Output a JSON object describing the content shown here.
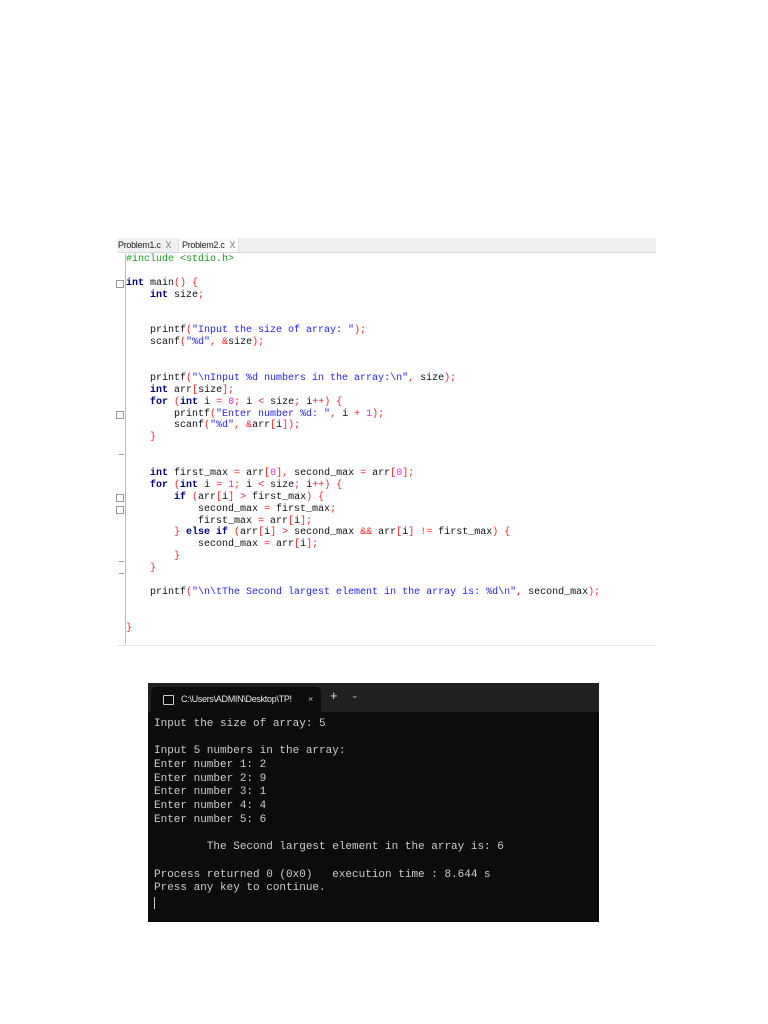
{
  "editor": {
    "tabs": [
      {
        "label": "Problem1.c",
        "close": "X"
      },
      {
        "label": "Problem2.c",
        "close": "X"
      }
    ],
    "code_lines": [
      [
        [
          "#include <stdio.h>",
          "pp"
        ]
      ],
      [],
      [
        [
          "int",
          "kw"
        ],
        [
          " main",
          "id"
        ],
        [
          "() {",
          "op"
        ]
      ],
      [
        [
          "    ",
          ""
        ],
        [
          "int",
          "kw"
        ],
        [
          " size",
          "id"
        ],
        [
          ";",
          "op"
        ]
      ],
      [],
      [],
      [
        [
          "    printf",
          "id"
        ],
        [
          "(",
          "op"
        ],
        [
          "\"Input the size of array: \"",
          "st"
        ],
        [
          ");",
          "op"
        ]
      ],
      [
        [
          "    scanf",
          "id"
        ],
        [
          "(",
          "op"
        ],
        [
          "\"%d\"",
          "st"
        ],
        [
          ", &",
          "op"
        ],
        [
          "size",
          "id"
        ],
        [
          ");",
          "op"
        ]
      ],
      [],
      [],
      [
        [
          "    printf",
          "id"
        ],
        [
          "(",
          "op"
        ],
        [
          "\"\\nInput %d numbers in the array:\\n\"",
          "st"
        ],
        [
          ", ",
          "op"
        ],
        [
          "size",
          "id"
        ],
        [
          ");",
          "op"
        ]
      ],
      [
        [
          "    ",
          ""
        ],
        [
          "int",
          "kw"
        ],
        [
          " arr",
          "id"
        ],
        [
          "[",
          "op"
        ],
        [
          "size",
          "id"
        ],
        [
          "];",
          "op"
        ]
      ],
      [
        [
          "    ",
          ""
        ],
        [
          "for",
          "kw"
        ],
        [
          " (",
          "op"
        ],
        [
          "int",
          "kw"
        ],
        [
          " i ",
          "id"
        ],
        [
          "=",
          "op"
        ],
        [
          " ",
          ""
        ],
        [
          "0",
          "nu"
        ],
        [
          ";",
          "op"
        ],
        [
          " i ",
          "id"
        ],
        [
          "<",
          "op"
        ],
        [
          " size",
          "id"
        ],
        [
          ";",
          "op"
        ],
        [
          " i",
          "id"
        ],
        [
          "++) {",
          "op"
        ]
      ],
      [
        [
          "        printf",
          "id"
        ],
        [
          "(",
          "op"
        ],
        [
          "\"Enter number %d: \"",
          "st"
        ],
        [
          ", ",
          "op"
        ],
        [
          "i ",
          "id"
        ],
        [
          "+",
          "op"
        ],
        [
          " ",
          ""
        ],
        [
          "1",
          "nu"
        ],
        [
          ");",
          "op"
        ]
      ],
      [
        [
          "        scanf",
          "id"
        ],
        [
          "(",
          "op"
        ],
        [
          "\"%d\"",
          "st"
        ],
        [
          ", &",
          "op"
        ],
        [
          "arr",
          "id"
        ],
        [
          "[",
          "op"
        ],
        [
          "i",
          "id"
        ],
        [
          "]);",
          "op"
        ]
      ],
      [
        [
          "    }",
          "op"
        ]
      ],
      [],
      [],
      [
        [
          "    ",
          ""
        ],
        [
          "int",
          "kw"
        ],
        [
          " first_max ",
          "id"
        ],
        [
          "=",
          "op"
        ],
        [
          " arr",
          "id"
        ],
        [
          "[",
          "op"
        ],
        [
          "0",
          "nu"
        ],
        [
          "],",
          "op"
        ],
        [
          " second_max ",
          "id"
        ],
        [
          "=",
          "op"
        ],
        [
          " arr",
          "id"
        ],
        [
          "[",
          "op"
        ],
        [
          "0",
          "nu"
        ],
        [
          "];",
          "op"
        ]
      ],
      [
        [
          "    ",
          ""
        ],
        [
          "for",
          "kw"
        ],
        [
          " (",
          "op"
        ],
        [
          "int",
          "kw"
        ],
        [
          " i ",
          "id"
        ],
        [
          "=",
          "op"
        ],
        [
          " ",
          ""
        ],
        [
          "1",
          "nu"
        ],
        [
          ";",
          "op"
        ],
        [
          " i ",
          "id"
        ],
        [
          "<",
          "op"
        ],
        [
          " size",
          "id"
        ],
        [
          ";",
          "op"
        ],
        [
          " i",
          "id"
        ],
        [
          "++) {",
          "op"
        ]
      ],
      [
        [
          "        ",
          ""
        ],
        [
          "if",
          "kw"
        ],
        [
          " (",
          "op"
        ],
        [
          "arr",
          "id"
        ],
        [
          "[",
          "op"
        ],
        [
          "i",
          "id"
        ],
        [
          "]",
          "op"
        ],
        [
          " ",
          ""
        ],
        [
          ">",
          "op"
        ],
        [
          " first_max",
          "id"
        ],
        [
          ") {",
          "op"
        ]
      ],
      [
        [
          "            second_max ",
          "id"
        ],
        [
          "=",
          "op"
        ],
        [
          " first_max",
          "id"
        ],
        [
          ";",
          "op"
        ]
      ],
      [
        [
          "            first_max ",
          "id"
        ],
        [
          "=",
          "op"
        ],
        [
          " arr",
          "id"
        ],
        [
          "[",
          "op"
        ],
        [
          "i",
          "id"
        ],
        [
          "];",
          "op"
        ]
      ],
      [
        [
          "        } ",
          "op"
        ],
        [
          "else if",
          "kw"
        ],
        [
          " (",
          "op"
        ],
        [
          "arr",
          "id"
        ],
        [
          "[",
          "op"
        ],
        [
          "i",
          "id"
        ],
        [
          "]",
          "op"
        ],
        [
          " > ",
          "op"
        ],
        [
          "second_max ",
          "id"
        ],
        [
          "&&",
          "op"
        ],
        [
          " arr",
          "id"
        ],
        [
          "[",
          "op"
        ],
        [
          "i",
          "id"
        ],
        [
          "]",
          "op"
        ],
        [
          " != ",
          "op"
        ],
        [
          "first_max",
          "id"
        ],
        [
          ") {",
          "op"
        ]
      ],
      [
        [
          "            second_max ",
          "id"
        ],
        [
          "=",
          "op"
        ],
        [
          " arr",
          "id"
        ],
        [
          "[",
          "op"
        ],
        [
          "i",
          "id"
        ],
        [
          "];",
          "op"
        ]
      ],
      [
        [
          "        }",
          "op"
        ]
      ],
      [
        [
          "    }",
          "op"
        ]
      ],
      [],
      [
        [
          "    printf",
          "id"
        ],
        [
          "(",
          "op"
        ],
        [
          "\"\\n\\tThe Second largest element in the array is: %d\\n\"",
          "st"
        ],
        [
          ", ",
          "op"
        ],
        [
          "second_max",
          "id"
        ],
        [
          ");",
          "op"
        ]
      ],
      [],
      [],
      [
        [
          "}",
          "op"
        ]
      ]
    ]
  },
  "terminal": {
    "tab_title": "C:\\Users\\ADMIN\\Desktop\\TP!",
    "tab_close": "×",
    "new_tab": "+",
    "dropdown": "⌄",
    "lines": [
      "Input the size of array: 5",
      "",
      "Input 5 numbers in the array:",
      "Enter number 1: 2",
      "Enter number 2: 9",
      "Enter number 3: 1",
      "Enter number 4: 4",
      "Enter number 5: 6",
      "",
      "        The Second largest element in the array is: 6",
      "",
      "Process returned 0 (0x0)   execution time : 8.644 s",
      "Press any key to continue."
    ]
  }
}
